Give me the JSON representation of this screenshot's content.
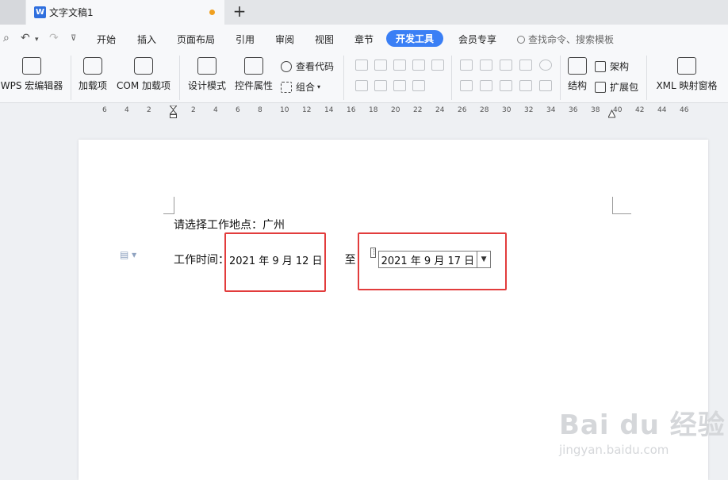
{
  "tabbar": {
    "doc_title": "文字文稿1",
    "logo": "W",
    "new_tab": "+"
  },
  "menu": {
    "items": [
      "开始",
      "插入",
      "页面布局",
      "引用",
      "审阅",
      "视图",
      "章节",
      "开发工具",
      "会员专享"
    ],
    "active": "开发工具",
    "search_placeholder": "查找命令、搜索模板"
  },
  "ribbon": {
    "macro_editor": "WPS 宏编辑器",
    "addins": "加载项",
    "com_addins": "COM 加载项",
    "design_mode": "设计模式",
    "control_props": "控件属性",
    "view_code": "查看代码",
    "group": "组合",
    "structure": "结构",
    "schema": "架构",
    "expansion_pack": "扩展包",
    "xml_mapping": "XML 映射窗格"
  },
  "ruler": {
    "ticks": [
      "6",
      "4",
      "2",
      "2",
      "4",
      "6",
      "8",
      "10",
      "12",
      "14",
      "16",
      "18",
      "20",
      "22",
      "24",
      "26",
      "28",
      "30",
      "32",
      "34",
      "36",
      "38",
      "40",
      "42",
      "44",
      "46"
    ]
  },
  "document": {
    "line1": "请选择工作地点：广州",
    "work_time_label": "工作时间：",
    "start_date": "2021 年 9 月 12 日",
    "to": "至",
    "end_date": "2021 年 9 月 17 日"
  },
  "watermark": {
    "logo": "Bai du 经验",
    "url": "jingyan.baidu.com"
  },
  "colors": {
    "accent": "#3a7ff5",
    "highlight": "#e23c3c",
    "dirty": "#f0a020"
  }
}
